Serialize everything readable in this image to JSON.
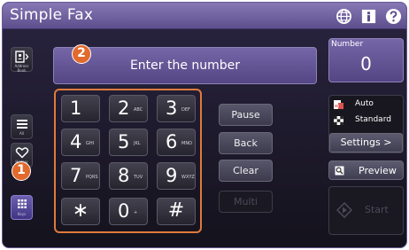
{
  "app": {
    "title": "Simple Fax"
  },
  "header_icons": [
    "globe-icon",
    "info-icon",
    "help-icon"
  ],
  "sidebar": {
    "address_book_label": "Address Book",
    "all_label": "All",
    "history_label": "History",
    "keys_label": "Keys"
  },
  "callouts": {
    "first": "1",
    "second": "2"
  },
  "number_entry": {
    "placeholder": "Enter the number"
  },
  "keypad": {
    "keys": [
      {
        "digit": "1",
        "letters": ""
      },
      {
        "digit": "2",
        "letters": "ABC"
      },
      {
        "digit": "3",
        "letters": "DEF"
      },
      {
        "digit": "4",
        "letters": "GHI"
      },
      {
        "digit": "5",
        "letters": "JKL"
      },
      {
        "digit": "6",
        "letters": "MNO"
      },
      {
        "digit": "7",
        "letters": "PQRS"
      },
      {
        "digit": "8",
        "letters": "TUV"
      },
      {
        "digit": "9",
        "letters": "WXYZ"
      },
      {
        "digit": "∗",
        "letters": ""
      },
      {
        "digit": "0",
        "letters": "+"
      },
      {
        "digit": "#",
        "letters": ""
      }
    ]
  },
  "actions": {
    "pause": "Pause",
    "backspace": "Back Space",
    "clear": "Clear",
    "multi": "Multi"
  },
  "number_panel": {
    "label": "Number",
    "count": "0"
  },
  "settings_panel": {
    "line1": "Auto",
    "line2": "Standard",
    "button": "Settings  >"
  },
  "preview": {
    "label": "Preview"
  },
  "start": {
    "label": "Start"
  },
  "colors": {
    "title_bar": "#6f61a2",
    "accent_panel": "#6a5b9c",
    "callout": "#e26a2c",
    "keypad_frame": "#e07a3c"
  }
}
